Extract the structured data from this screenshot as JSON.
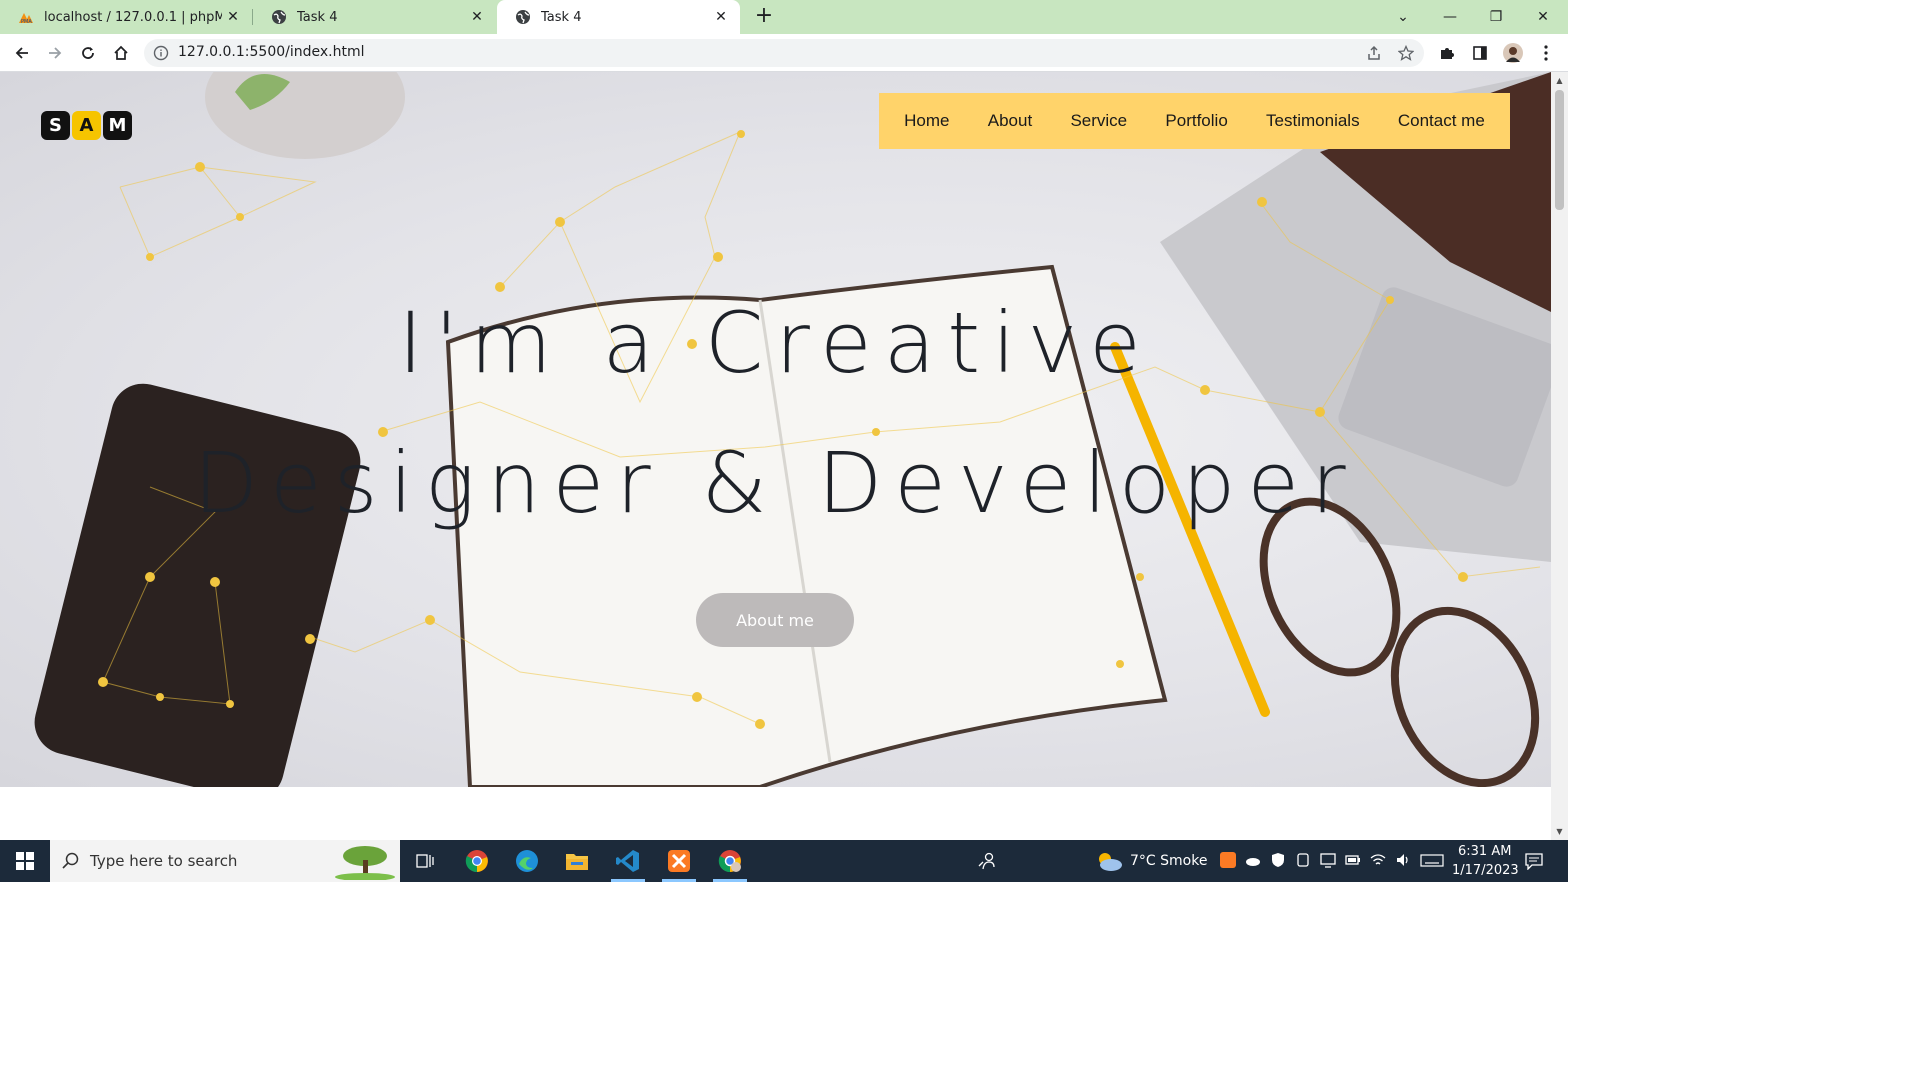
{
  "browser": {
    "tabs": [
      {
        "title": "localhost / 127.0.0.1 | phpMyAdmin",
        "active": false
      },
      {
        "title": "Task 4",
        "active": false
      },
      {
        "title": "Task 4",
        "active": true
      }
    ],
    "url": "127.0.0.1:5500/index.html"
  },
  "page": {
    "logo_letters": [
      "S",
      "A",
      "M"
    ],
    "nav": [
      "Home",
      "About",
      "Service",
      "Portfolio",
      "Testimonials",
      "Contact me"
    ],
    "headline_line1": "I'm a Creative",
    "headline_line2": "Designer & Developer",
    "cta_label": "About me"
  },
  "taskbar": {
    "search_placeholder": "Type here to search",
    "weather": "7°C  Smoke",
    "time": "6:31 AM",
    "date": "1/17/2023"
  },
  "colors": {
    "tabbar": "#c8e6c0",
    "nav_bg": "#ffd36a",
    "cta_bg": "#bdbaba",
    "accent_yellow": "#f6c400"
  }
}
